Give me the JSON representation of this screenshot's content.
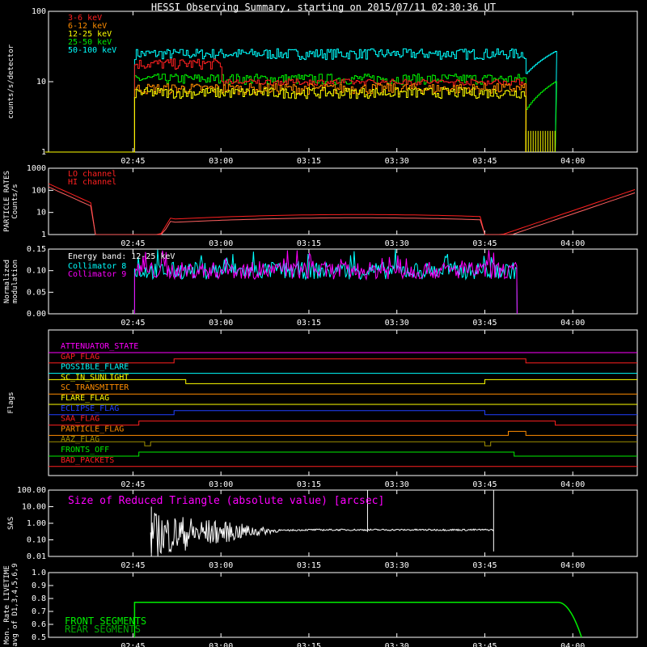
{
  "title": "HESSI Observing Summary, starting on 2015/07/11 02:30:36 UT",
  "time_ticks": [
    "02:45",
    "03:00",
    "03:15",
    "03:30",
    "03:45",
    "04:00"
  ],
  "chart_data": [
    {
      "id": "counts",
      "type": "line",
      "ylabel": "counts/s/detector",
      "yscale": "log",
      "ylim": [
        1,
        100
      ],
      "yticks": [
        "1",
        "10",
        "100"
      ],
      "series": [
        {
          "name": "3-6 keV",
          "color": "#ff2020",
          "start": "02:45",
          "end": "03:52",
          "level": 18
        },
        {
          "name": "6-12 keV",
          "color": "#ff8c00",
          "start": "02:45",
          "end": "03:52",
          "level": 8
        },
        {
          "name": "12-25 keV",
          "color": "#ffff00",
          "start": "02:45",
          "end": "03:52",
          "level": 7
        },
        {
          "name": "25-50 keV",
          "color": "#00ee00",
          "start": "02:45",
          "end": "03:57",
          "level": 11
        },
        {
          "name": "50-100 keV",
          "color": "#00ffff",
          "start": "02:45",
          "end": "03:57",
          "level": 25
        }
      ]
    },
    {
      "id": "particle",
      "type": "line",
      "ylabel": "PARTICLE RATES Counts/s",
      "yscale": "log",
      "ylim": [
        1,
        1000
      ],
      "yticks": [
        "1",
        "10",
        "100",
        "1000"
      ],
      "series": [
        {
          "name": "LO channel",
          "color": "#ff2020"
        },
        {
          "name": "HI channel",
          "color": "#ff2020"
        }
      ]
    },
    {
      "id": "modulation",
      "type": "line",
      "ylabel": "Normalized modulation",
      "ylim": [
        0,
        0.15
      ],
      "yticks": [
        "0.00",
        "0.05",
        "0.10",
        "0.15"
      ],
      "annotation": "Energy band: 12-25 keV",
      "series": [
        {
          "name": "Collimator 8",
          "color": "#00ffff",
          "level": 0.1
        },
        {
          "name": "Collimator 9",
          "color": "#ff00ff",
          "level": 0.1
        }
      ]
    },
    {
      "id": "flags",
      "type": "line",
      "ylabel": "Flags",
      "series": [
        {
          "name": "ATTENUATOR_STATE",
          "color": "#ff00ff"
        },
        {
          "name": "GAP_FLAG",
          "color": "#ff2020"
        },
        {
          "name": "POSSIBLE_FLARE",
          "color": "#00ffff"
        },
        {
          "name": "SC_IN_SUNLIGHT",
          "color": "#ffff00"
        },
        {
          "name": "SC_TRANSMITTER",
          "color": "#ff8c00"
        },
        {
          "name": "FLARE_FLAG",
          "color": "#ffff00"
        },
        {
          "name": "ECLIPSE_FLAG",
          "color": "#2040ff"
        },
        {
          "name": "SAA_FLAG",
          "color": "#ff2020"
        },
        {
          "name": "PARTICLE_FLAG",
          "color": "#ff8c00"
        },
        {
          "name": "AAZ_FLAG",
          "color": "#a09000"
        },
        {
          "name": "FRONTS_OFF",
          "color": "#00ee00"
        },
        {
          "name": "BAD_PACKETS",
          "color": "#ff2020"
        }
      ]
    },
    {
      "id": "sas",
      "type": "line",
      "ylabel": "SAS",
      "yscale": "log",
      "ylim": [
        0.01,
        100
      ],
      "yticks": [
        "0.01",
        "0.10",
        "1.00",
        "10.00",
        "100.00"
      ],
      "annotation": "Size of Reduced Triangle (absolute value) [arcsec]",
      "series": [
        {
          "color": "#ffffff"
        }
      ]
    },
    {
      "id": "livetime",
      "type": "line",
      "ylabel": "Mon. Rate LIVETIME avg of D1,3,4,5,6,9",
      "ylim": [
        0.5,
        1.0
      ],
      "yticks": [
        "0.5",
        "0.6",
        "0.7",
        "0.8",
        "0.9",
        "1.0"
      ],
      "series": [
        {
          "name": "FRONT SEGMENTS",
          "color": "#00ee00",
          "level": 0.77
        },
        {
          "name": "REAR SEGMENTS",
          "color": "#00aa00"
        }
      ]
    }
  ]
}
